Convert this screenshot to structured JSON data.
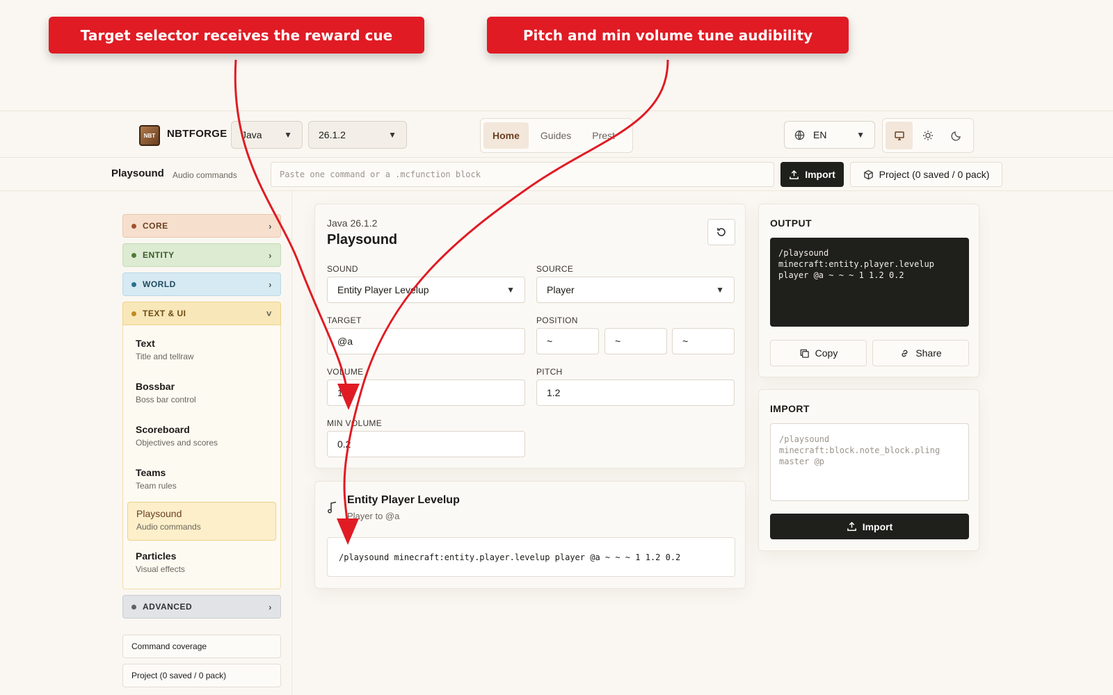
{
  "annotations": {
    "left": "Target selector receives the reward cue",
    "right": "Pitch and min volume tune audibility"
  },
  "header": {
    "brand": "NBTFORGE",
    "logo_text": "NBT",
    "edition": "Java",
    "version": "26.1.2",
    "nav": [
      "Home",
      "Guides",
      "Prest"
    ],
    "language": "EN"
  },
  "subbar": {
    "title": "Playsound",
    "subtitle": "Audio commands",
    "paste_placeholder": "Paste one command or a .mcfunction block",
    "import_label": "Import",
    "project_label": "Project (0 saved / 0 pack)"
  },
  "sidebar": {
    "categories": {
      "core": "CORE",
      "entity": "ENTITY",
      "world": "WORLD",
      "text_ui": "TEXT & UI",
      "advanced": "ADVANCED"
    },
    "items": [
      {
        "title": "Text",
        "desc": "Title and tellraw"
      },
      {
        "title": "Bossbar",
        "desc": "Boss bar control"
      },
      {
        "title": "Scoreboard",
        "desc": "Objectives and scores"
      },
      {
        "title": "Teams",
        "desc": "Team rules"
      },
      {
        "title": "Playsound",
        "desc": "Audio commands"
      },
      {
        "title": "Particles",
        "desc": "Visual effects"
      }
    ],
    "coverage": "Command coverage",
    "project": "Project (0 saved / 0 pack)"
  },
  "editor": {
    "version": "Java 26.1.2",
    "title": "Playsound",
    "sound_label": "SOUND",
    "sound_value": "Entity Player Levelup",
    "source_label": "SOURCE",
    "source_value": "Player",
    "target_label": "TARGET",
    "target_value": "@a",
    "position_label": "POSITION",
    "pos_x": "~",
    "pos_y": "~",
    "pos_z": "~",
    "volume_label": "VOLUME",
    "volume_value": "1",
    "pitch_label": "PITCH",
    "pitch_value": "1.2",
    "min_volume_label": "MIN VOLUME",
    "min_volume_value": "0.2"
  },
  "preview": {
    "title": "Entity Player Levelup",
    "subtitle": "Player to @a",
    "command": "/playsound minecraft:entity.player.levelup player @a ~ ~ ~ 1 1.2 0.2"
  },
  "output": {
    "title": "OUTPUT",
    "lines": [
      "/playsound",
      "minecraft:entity.player.levelup",
      "player @a ~ ~ ~ 1 1.2 0.2"
    ],
    "copy_label": "Copy",
    "share_label": "Share"
  },
  "import": {
    "title": "IMPORT",
    "placeholder_lines": [
      "/playsound",
      "minecraft:block.note_block.pling",
      "master @p"
    ],
    "button_label": "Import"
  },
  "colors": {
    "annotation": "#e01b24",
    "dark": "#1f1f1b",
    "accent_brown": "#6b3f22",
    "core_bg": "#f6dfcd",
    "entity_bg": "#dcebd2",
    "world_bg": "#d6eaf3",
    "text_ui_bg": "#f8e7b8",
    "advanced_bg": "#e1e3e6"
  }
}
